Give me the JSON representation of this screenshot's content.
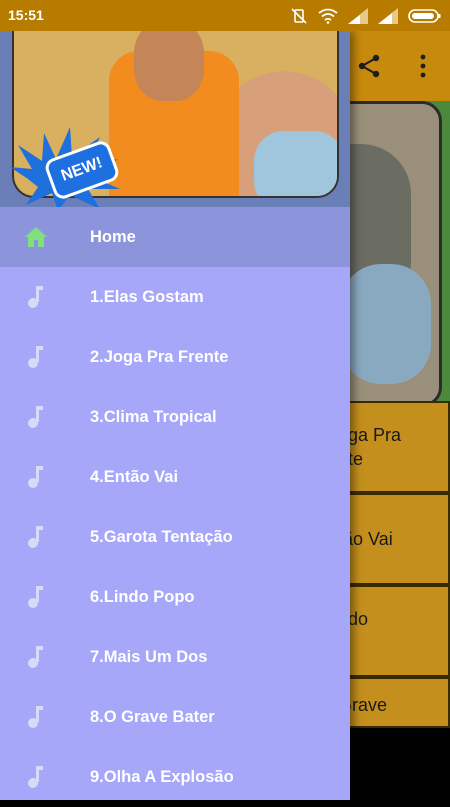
{
  "status_bar": {
    "time": "15:51"
  },
  "background_app": {
    "song_cards": [
      {
        "text": "oga Pra\nnte"
      },
      {
        "text": "tão Vai"
      },
      {
        "text": "ndo\no"
      },
      {
        "text": "Grave"
      }
    ]
  },
  "drawer": {
    "badge": "NEW!",
    "menu": [
      {
        "label": "Home",
        "icon": "home-icon"
      },
      {
        "label": "1.Elas Gostam",
        "icon": "music-note-icon"
      },
      {
        "label": "2.Joga Pra Frente",
        "icon": "music-note-icon"
      },
      {
        "label": "3.Clima Tropical",
        "icon": "music-note-icon"
      },
      {
        "label": "4.Então Vai",
        "icon": "music-note-icon"
      },
      {
        "label": "5.Garota Tentação",
        "icon": "music-note-icon"
      },
      {
        "label": "6.Lindo Popo",
        "icon": "music-note-icon"
      },
      {
        "label": "7.Mais Um Dos",
        "icon": "music-note-icon"
      },
      {
        "label": "8.O Grave Bater",
        "icon": "music-note-icon"
      },
      {
        "label": "9.Olha A Explosão",
        "icon": "music-note-icon"
      }
    ]
  },
  "colors": {
    "status_bar": "#b77b00",
    "drawer_bg": "#a6a7f8",
    "active_item": "#8c94db",
    "home_icon": "#7ee07e",
    "note_icon": "#d7dbfa"
  }
}
